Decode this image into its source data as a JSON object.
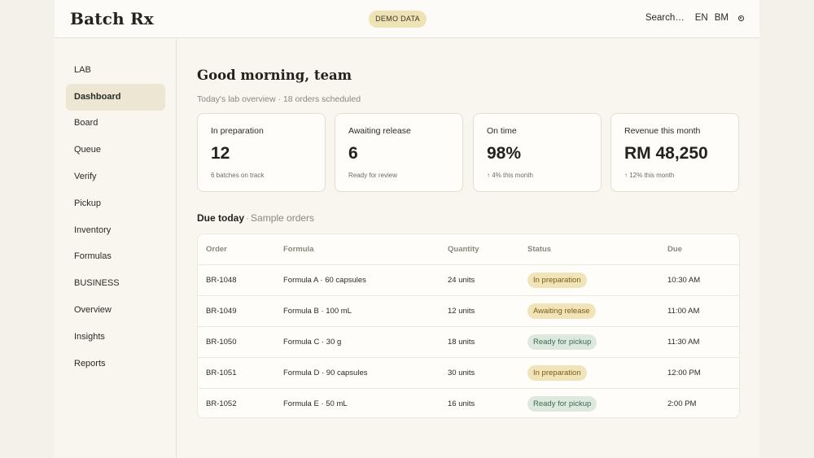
{
  "header": {
    "brand": "Batch Rx",
    "badge": "DEMO DATA",
    "search": "Search…",
    "lang_en": "EN",
    "lang_bm": "BM"
  },
  "sidebar": {
    "items": [
      {
        "label": "LAB",
        "type": "section"
      },
      {
        "label": "Dashboard",
        "type": "link",
        "active": true
      },
      {
        "label": "Board",
        "type": "link"
      },
      {
        "label": "Queue",
        "type": "link"
      },
      {
        "label": "Verify",
        "type": "link"
      },
      {
        "label": "Pickup",
        "type": "link"
      },
      {
        "label": "Inventory",
        "type": "link"
      },
      {
        "label": "Formulas",
        "type": "link"
      },
      {
        "label": "BUSINESS",
        "type": "section"
      },
      {
        "label": "Overview",
        "type": "link"
      },
      {
        "label": "Insights",
        "type": "link"
      },
      {
        "label": "Reports",
        "type": "link"
      }
    ]
  },
  "main": {
    "greeting": "Good morning, team",
    "subtitle": "Today's lab overview · 18 orders scheduled",
    "cards": [
      {
        "label": "In preparation",
        "value": "12",
        "note": "6 batches on track"
      },
      {
        "label": "Awaiting release",
        "value": "6",
        "note": "Ready for review"
      },
      {
        "label": "On time",
        "value": "98%",
        "note": "↑ 4% this month"
      },
      {
        "label": "Revenue this month",
        "value": "RM 48,250",
        "note": "↑ 12% this month"
      }
    ],
    "due_title": "Due today",
    "due_subtitle": "Sample orders",
    "table": {
      "headers": [
        "Order",
        "Formula",
        "Quantity",
        "Status",
        "Due"
      ],
      "rows": [
        {
          "order": "BR-1048",
          "formula": "Formula A · 60 capsules",
          "quantity": "24 units",
          "status": "In preparation",
          "status_kind": "prep",
          "due": "10:30 AM"
        },
        {
          "order": "BR-1049",
          "formula": "Formula B · 100 mL",
          "quantity": "12 units",
          "status": "Awaiting release",
          "status_kind": "await",
          "due": "11:00 AM"
        },
        {
          "order": "BR-1050",
          "formula": "Formula C · 30 g",
          "quantity": "18 units",
          "status": "Ready for pickup",
          "status_kind": "ready",
          "due": "11:30 AM"
        },
        {
          "order": "BR-1051",
          "formula": "Formula D · 90 capsules",
          "quantity": "30 units",
          "status": "In preparation",
          "status_kind": "prep",
          "due": "12:00 PM"
        },
        {
          "order": "BR-1052",
          "formula": "Formula E · 50 mL",
          "quantity": "16 units",
          "status": "Ready for pickup",
          "status_kind": "ready",
          "due": "2:00 PM"
        }
      ]
    }
  },
  "colors": {
    "background": "#f3f1e9",
    "accent_badge": "#efe2b4",
    "status_pending": "#f1e4b8",
    "status_ready": "#dde9de"
  }
}
